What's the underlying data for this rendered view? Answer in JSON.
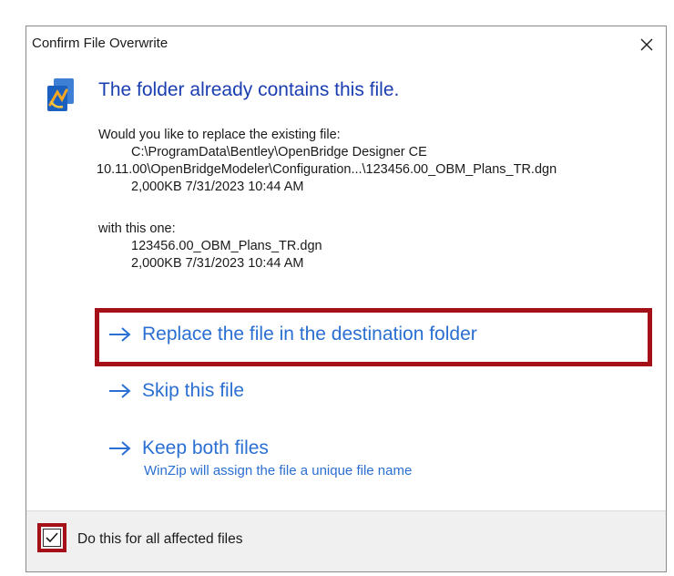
{
  "dialog": {
    "title": "Confirm File Overwrite",
    "heading": "The folder already contains this file.",
    "existing": {
      "intro": "Would you like to replace the existing file:",
      "path_line1": "C:\\ProgramData\\Bentley\\OpenBridge Designer CE",
      "path_line2": "10.11.00\\OpenBridgeModeler\\Configuration...\\123456.00_OBM_Plans_TR.dgn",
      "meta": "2,000KB  7/31/2023  10:44 AM"
    },
    "replacement": {
      "intro": "with this one:",
      "name": "123456.00_OBM_Plans_TR.dgn",
      "meta": "2,000KB  7/31/2023  10:44 AM"
    },
    "options": {
      "replace": "Replace the file in the destination folder",
      "skip": "Skip this file",
      "keep_both": "Keep both files",
      "keep_both_sub": "WinZip will assign the file a unique file name"
    },
    "footer": {
      "checkbox_label": "Do this for all affected files",
      "checkbox_checked": true
    }
  },
  "colors": {
    "heading": "#1a3eb0",
    "link": "#2a6fd1",
    "highlight": "#a50f17",
    "footer_bg": "#f0f0f0"
  },
  "icons": {
    "app": "copy-file-icon",
    "close": "close-icon",
    "arrow": "arrow-right-icon",
    "check": "checkmark-icon"
  }
}
